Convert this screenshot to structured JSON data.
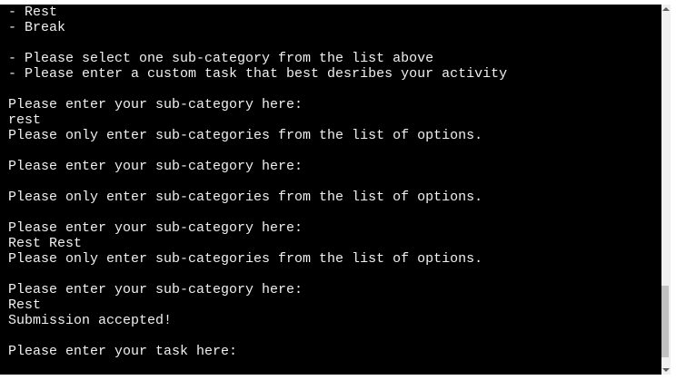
{
  "terminal": {
    "lines": [
      "- Rest",
      "- Break",
      "",
      "- Please select one sub-category from the list above",
      "- Please enter a custom task that best desribes your activity",
      "",
      "Please enter your sub-category here:",
      "rest",
      "Please only enter sub-categories from the list of options.",
      "",
      "Please enter your sub-category here:",
      "",
      "Please only enter sub-categories from the list of options.",
      "",
      "Please enter your sub-category here:",
      "Rest Rest",
      "Please only enter sub-categories from the list of options.",
      "",
      "Please enter your sub-category here:",
      "Rest",
      "Submission accepted!",
      "",
      "Please enter your task here:"
    ],
    "background": "#000000",
    "text_color": "#f0f0f0"
  },
  "scrollbar": {
    "position_percent": 100
  }
}
